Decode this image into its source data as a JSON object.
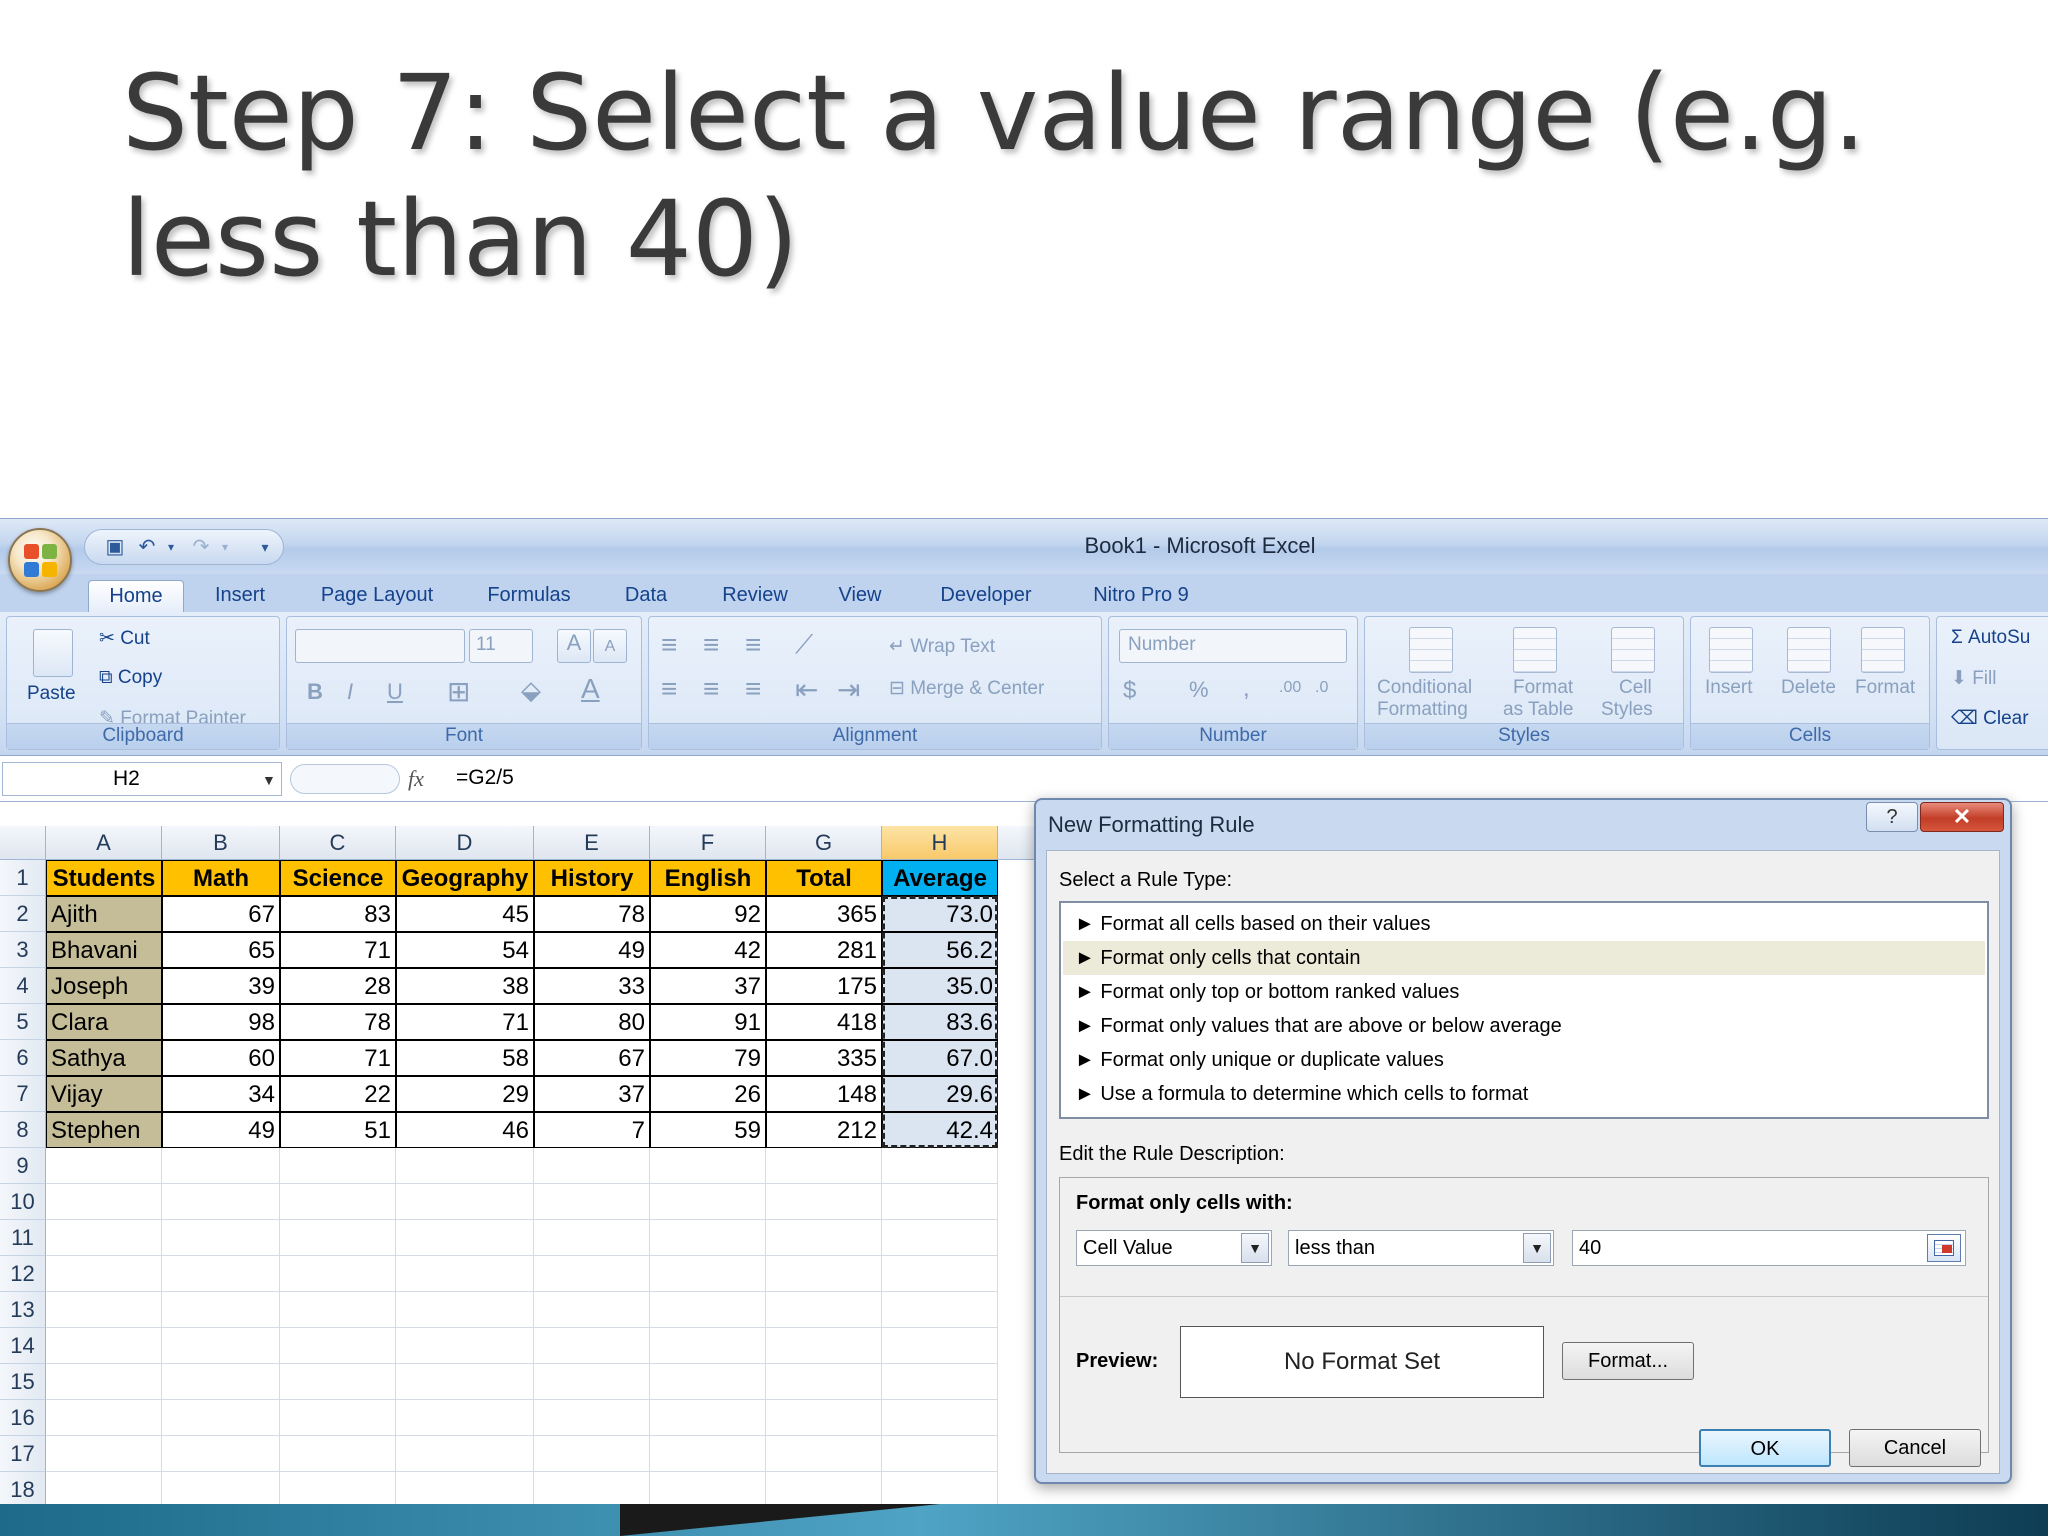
{
  "slide": {
    "title": "Step 7: Select a value range (e.g. less than 40)"
  },
  "window": {
    "title": "Book1 - Microsoft Excel"
  },
  "tabs": [
    "Home",
    "Insert",
    "Page Layout",
    "Formulas",
    "Data",
    "Review",
    "View",
    "Developer",
    "Nitro Pro 9"
  ],
  "ribbon": {
    "clipboard": {
      "paste": "Paste",
      "cut": "Cut",
      "copy": "Copy",
      "format_painter": "Format Painter",
      "label": "Clipboard"
    },
    "font": {
      "size": "11",
      "bold": "B",
      "italic": "I",
      "underline": "U",
      "grow": "A",
      "shrink": "A",
      "label": "Font"
    },
    "alignment": {
      "wrap": "Wrap Text",
      "merge": "Merge & Center",
      "label": "Alignment"
    },
    "number": {
      "format": "Number",
      "percent": "%",
      "comma": ",",
      "label": "Number"
    },
    "styles": {
      "conditional": "Conditional",
      "conditional2": "Formatting",
      "format_table": "Format",
      "format_table2": "as Table",
      "cell_styles": "Cell",
      "cell_styles2": "Styles",
      "label": "Styles"
    },
    "cells": {
      "insert": "Insert",
      "delete": "Delete",
      "format": "Format",
      "label": "Cells"
    },
    "editing": {
      "autosum": "AutoSu",
      "fill": "Fill",
      "clear": "Clear",
      "sigma": "Σ"
    }
  },
  "formula_bar": {
    "name_box": "H2",
    "fx": "fx",
    "formula": "=G2/5"
  },
  "sheet": {
    "columns": [
      "A",
      "B",
      "C",
      "D",
      "E",
      "F",
      "G",
      "H"
    ],
    "rows": [
      "1",
      "2",
      "3",
      "4",
      "5",
      "6",
      "7",
      "8",
      "9",
      "10",
      "11",
      "12",
      "13",
      "14",
      "15",
      "16",
      "17",
      "18"
    ],
    "headers": [
      "Students",
      "Math",
      "Science",
      "Geography",
      "History",
      "English",
      "Total",
      "Average"
    ],
    "data": [
      [
        "Ajith",
        "67",
        "83",
        "45",
        "78",
        "92",
        "365",
        "73.0"
      ],
      [
        "Bhavani",
        "65",
        "71",
        "54",
        "49",
        "42",
        "281",
        "56.2"
      ],
      [
        "Joseph",
        "39",
        "28",
        "38",
        "33",
        "37",
        "175",
        "35.0"
      ],
      [
        "Clara",
        "98",
        "78",
        "71",
        "80",
        "91",
        "418",
        "83.6"
      ],
      [
        "Sathya",
        "60",
        "71",
        "58",
        "67",
        "79",
        "335",
        "67.0"
      ],
      [
        "Vijay",
        "34",
        "22",
        "29",
        "37",
        "26",
        "148",
        "29.6"
      ],
      [
        "Stephen",
        "49",
        "51",
        "46",
        "7",
        "59",
        "212",
        "42.4"
      ]
    ]
  },
  "dialog": {
    "title": "New Formatting Rule",
    "help": "?",
    "close": "✕",
    "select_rule_label": "Select a Rule Type:",
    "rules": [
      "► Format all cells based on their values",
      "► Format only cells that contain",
      "► Format only top or bottom ranked values",
      "► Format only values that are above or below average",
      "► Format only unique or duplicate values",
      "► Use a formula to determine which cells to format"
    ],
    "edit_label": "Edit the Rule Description:",
    "format_only_label": "Format only cells with:",
    "condition_type": "Cell Value",
    "operator": "less than",
    "value": "40",
    "preview_label": "Preview:",
    "preview_text": "No Format Set",
    "format_button": "Format...",
    "ok": "OK",
    "cancel": "Cancel"
  }
}
